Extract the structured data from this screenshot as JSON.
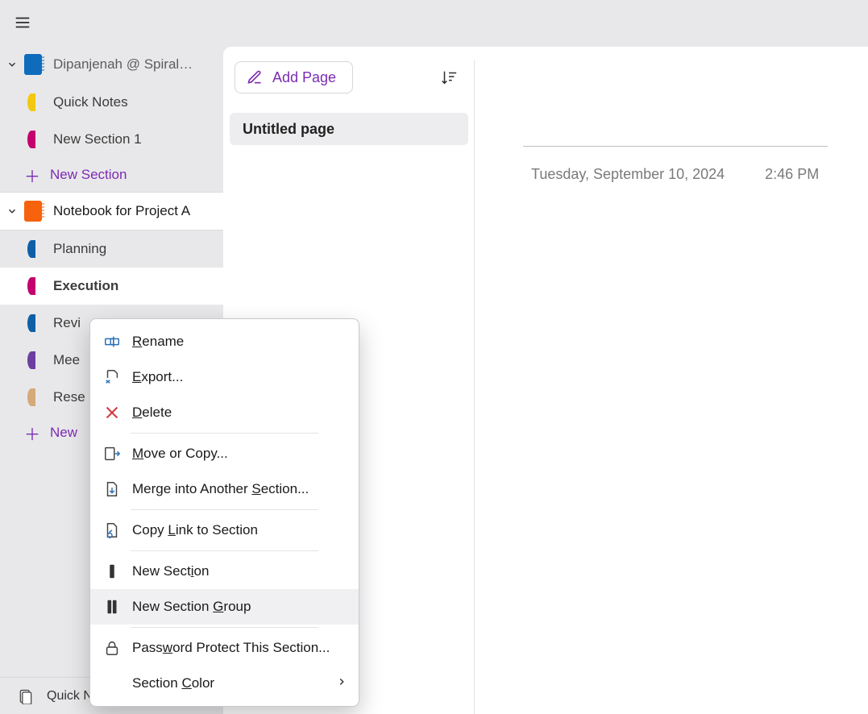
{
  "notebooks": [
    {
      "id": "nb1",
      "label": "Dipanjenah @ Spiral…",
      "color": "blue",
      "sections": [
        {
          "label": "Quick Notes",
          "color": "c-yellow"
        },
        {
          "label": "New Section 1",
          "color": "c-magenta"
        }
      ],
      "add_label": "New Section"
    },
    {
      "id": "nb2",
      "label": "Notebook for Project A",
      "color": "orange",
      "sections": [
        {
          "label": "Planning",
          "color": "c-blue"
        },
        {
          "label": "Execution",
          "color": "c-magenta",
          "active": true
        },
        {
          "label": "Revi",
          "color": "c-blue"
        },
        {
          "label": "Mee",
          "color": "c-purple"
        },
        {
          "label": "Rese",
          "color": "c-tan"
        }
      ],
      "add_label": "New"
    }
  ],
  "footer_quick": "Quick Notes",
  "pagelist": {
    "add_page": "Add Page",
    "pages": [
      {
        "title": "Untitled page",
        "selected": true
      }
    ]
  },
  "canvas": {
    "date": "Tuesday, September 10, 2024",
    "time": "2:46 PM"
  },
  "contextmenu": {
    "items": [
      {
        "icon": "rename",
        "label_pre": "",
        "u": "R",
        "label_post": "ename"
      },
      {
        "icon": "export",
        "label_pre": "",
        "u": "E",
        "label_post": "xport..."
      },
      {
        "icon": "delete",
        "label_pre": "",
        "u": "D",
        "label_post": "elete"
      },
      {
        "sep": true
      },
      {
        "icon": "move",
        "label_pre": "",
        "u": "M",
        "label_post": "ove or Copy..."
      },
      {
        "icon": "merge",
        "label_pre": "Merge into Another ",
        "u": "S",
        "label_post": "ection..."
      },
      {
        "sep": true
      },
      {
        "icon": "link",
        "label_pre": "Copy ",
        "u": "L",
        "label_post": "ink to Section"
      },
      {
        "sep": true
      },
      {
        "icon": "newsec",
        "label_pre": "New Sect",
        "u": "i",
        "label_post": "on"
      },
      {
        "icon": "newgrp",
        "label_pre": "New Section ",
        "u": "G",
        "label_post": "roup",
        "hover": true
      },
      {
        "sep": true
      },
      {
        "icon": "lock",
        "label_pre": "Pass",
        "u": "w",
        "label_post": "ord Protect This Section..."
      },
      {
        "icon": "",
        "label_pre": "Section ",
        "u": "C",
        "label_post": "olor",
        "submenu": true
      }
    ]
  }
}
